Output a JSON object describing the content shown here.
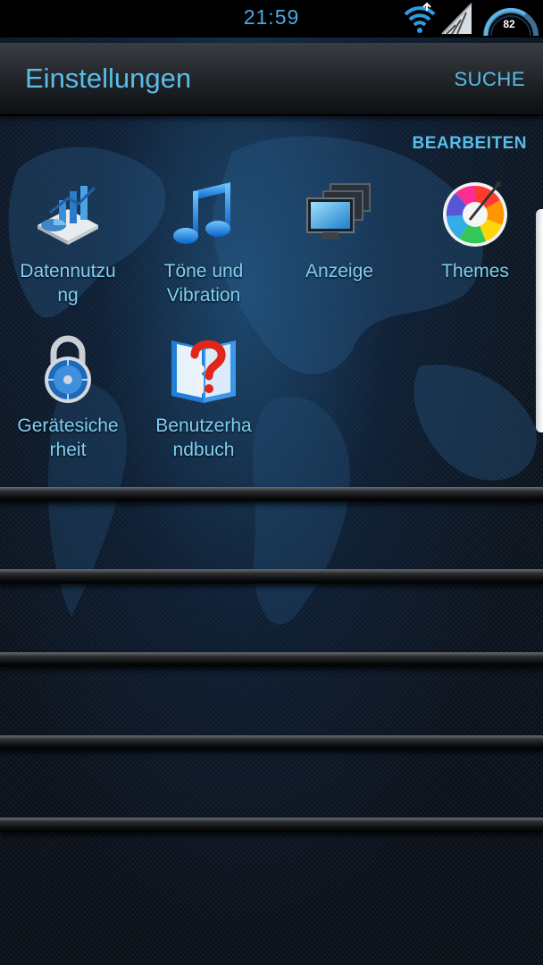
{
  "status_bar": {
    "time": "21:59",
    "battery_level": "82",
    "icons": [
      "wifi-icon",
      "signal-icon",
      "battery-gauge-icon"
    ]
  },
  "header": {
    "title": "Einstellungen",
    "search_label": "SUCHE"
  },
  "edit_label": "BEARBEITEN",
  "tiles": [
    {
      "label_line1": "Datennutzu",
      "label_line2": "ng",
      "icon": "data-usage-icon"
    },
    {
      "label_line1": "Töne und",
      "label_line2": "Vibration",
      "icon": "music-note-icon"
    },
    {
      "label_line1": "Anzeige",
      "label_line2": "",
      "icon": "display-monitors-icon"
    },
    {
      "label_line1": "Themes",
      "label_line2": "",
      "icon": "color-wheel-icon"
    },
    {
      "label_line1": "Gerätesiche",
      "label_line2": "rheit",
      "icon": "padlock-icon"
    },
    {
      "label_line1": "Benutzerha",
      "label_line2": "ndbuch",
      "icon": "help-book-icon"
    }
  ],
  "colors": {
    "accent": "#58bde9",
    "label": "#7fd0f2",
    "status_bar": "#000000"
  }
}
